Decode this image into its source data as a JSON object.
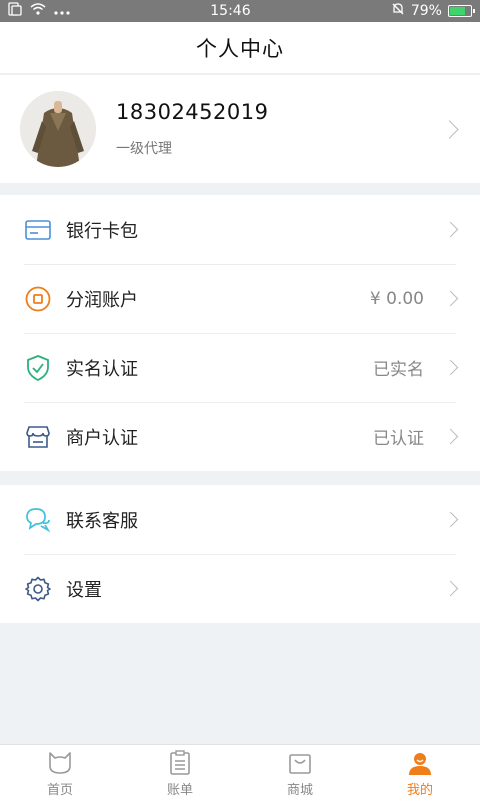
{
  "status_bar": {
    "time": "15:46",
    "battery": "79%",
    "battery_level": 0.79
  },
  "header": {
    "title": "个人中心"
  },
  "profile": {
    "phone": "18302452019",
    "role": "一级代理"
  },
  "menu_group_1": [
    {
      "label": "银行卡包",
      "value": "",
      "icon": "bank-card-icon"
    },
    {
      "label": "分润账户",
      "value": "¥ 0.00",
      "icon": "profit-account-icon"
    },
    {
      "label": "实名认证",
      "value": "已实名",
      "icon": "shield-check-icon"
    },
    {
      "label": "商户认证",
      "value": "已认证",
      "icon": "store-icon"
    }
  ],
  "menu_group_2": [
    {
      "label": "联系客服",
      "value": "",
      "icon": "chat-bubble-icon"
    },
    {
      "label": "设置",
      "value": "",
      "icon": "gear-icon"
    }
  ],
  "tabs": [
    {
      "label": "首页",
      "icon": "home-cat-icon",
      "active": false
    },
    {
      "label": "账单",
      "icon": "bill-icon",
      "active": false
    },
    {
      "label": "商城",
      "icon": "shopping-bag-icon",
      "active": false
    },
    {
      "label": "我的",
      "icon": "user-icon",
      "active": true
    }
  ],
  "colors": {
    "accent": "#ef7d1a",
    "icon_blue": "#4a90d9",
    "icon_green": "#2ab07a",
    "icon_navy": "#3d5a8a",
    "icon_cyan": "#3ec1d9"
  }
}
